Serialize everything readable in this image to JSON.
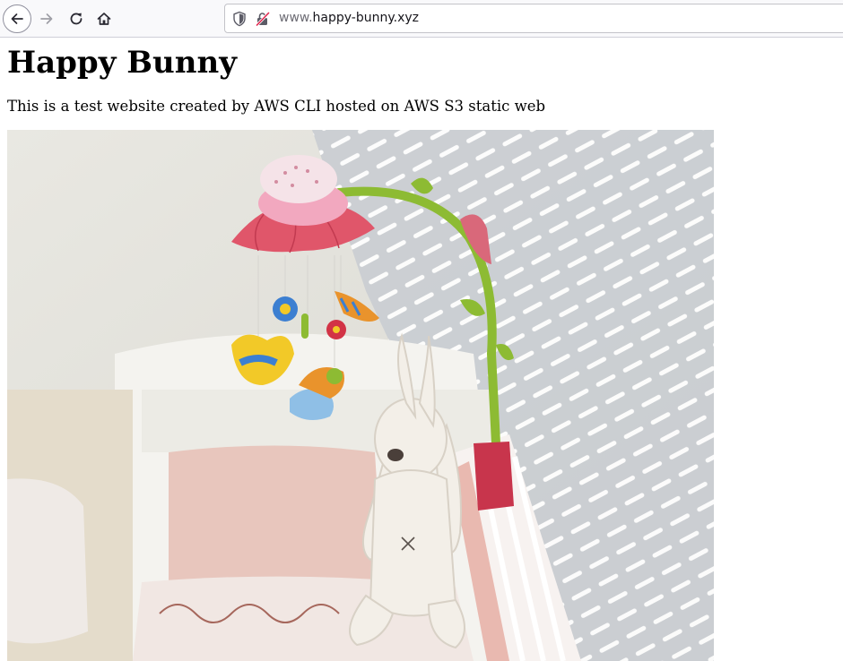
{
  "browser": {
    "url_prefix": "www.",
    "url_domain": "happy-bunny.xyz",
    "icons": {
      "back": "arrow-left-icon",
      "forward": "arrow-right-icon",
      "reload": "reload-icon",
      "home": "home-icon",
      "tracking_protection": "shield-icon",
      "connection": "insecure-connection-icon"
    }
  },
  "page": {
    "title": "Happy Bunny",
    "description": "This is a test website created by AWS CLI hosted on AWS S3 static web",
    "image_subject": "photo-of-crib-with-plush-bunny-and-mobile"
  },
  "colors": {
    "toolbar_bg": "#f9f9fb",
    "text": "#000000",
    "url_dim": "#6e6d75",
    "insecure_red": "#e22850"
  }
}
